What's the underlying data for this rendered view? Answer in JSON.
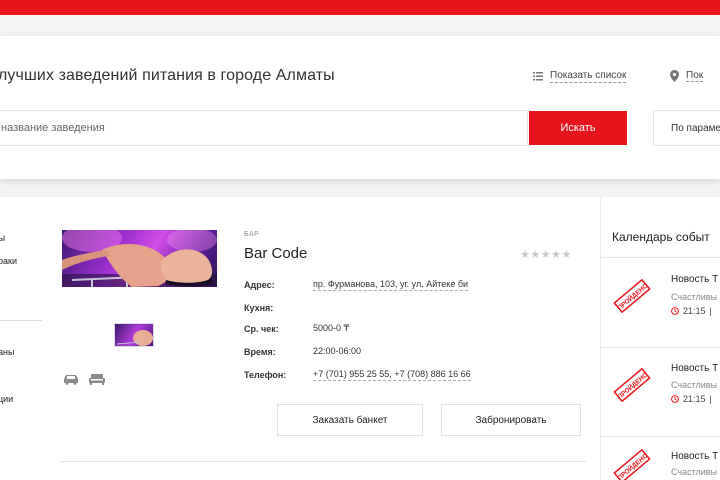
{
  "header": {
    "bar_color": "#e8141b"
  },
  "search": {
    "headline": "лучших заведений питания в городе Алматы",
    "show_list": "Показать список",
    "show_map": "Пок",
    "placeholder": "название заведения",
    "button": "Искать",
    "params": "По парамет"
  },
  "sidebar": {
    "items": [
      "ы",
      "раки",
      "аны",
      "ции"
    ]
  },
  "venue": {
    "category": "БАР",
    "title": "Bar Code",
    "rating_stars": "★★★★★",
    "rating_value": 0,
    "rating_max": 5,
    "info": [
      {
        "label": "Адрес:",
        "value": "пр. Фурманова, 103, уг. ул. Айтеке би"
      },
      {
        "label": "Кухня:",
        "value": ""
      },
      {
        "label": "Ср. чек:",
        "value": "5000-0 ₸"
      },
      {
        "label": "Время:",
        "value": "22:00-06:00"
      },
      {
        "label": "Телефон:",
        "value": "+7 (701) 955 25 55, +7 (708) 886 16 66"
      }
    ],
    "banquet_button": "Заказать банкет",
    "book_button": "Забронировать"
  },
  "calendar": {
    "title": "Календарь событ",
    "events": [
      {
        "title": "Новость Т",
        "subtitle": "Счастливы",
        "time": "21:15",
        "sep": "|",
        "stamp": "ПРОЙДЕНО"
      },
      {
        "title": "Новость Т",
        "subtitle": "Счастливы",
        "time": "21:15",
        "sep": "|",
        "stamp": "ПРОЙДЕНО"
      },
      {
        "title": "Новость Т",
        "subtitle": "Счастливы",
        "time": "",
        "sep": "",
        "stamp": "ПРОЙДЕНО"
      }
    ]
  },
  "icons": {
    "list": "list-icon",
    "map": "map-pin-icon",
    "car": "car-icon",
    "seat": "sofa-icon",
    "clock": "clock-icon"
  },
  "colors": {
    "accent": "#e8141b"
  }
}
